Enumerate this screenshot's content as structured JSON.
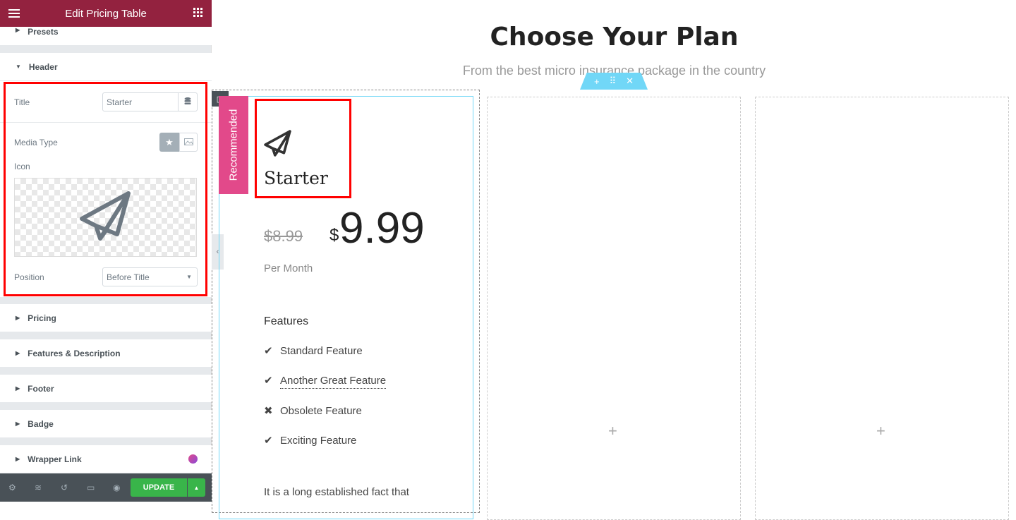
{
  "editor": {
    "title": "Edit Pricing Table",
    "menu_icon": "hamburger-icon",
    "apps_icon": "grid-icon",
    "sections": {
      "presets": "Presets",
      "header": "Header",
      "pricing": "Pricing",
      "features": "Features & Description",
      "footer": "Footer",
      "badge": "Badge",
      "wrapper_link": "Wrapper Link"
    },
    "controls": {
      "title_label": "Title",
      "title_value": "Starter",
      "media_type_label": "Media Type",
      "icon_label": "Icon",
      "position_label": "Position",
      "position_value": "Before Title"
    },
    "update_label": "UPDATE"
  },
  "page": {
    "heading": "Choose Your Plan",
    "subheading": "From the best micro insurance package in the country",
    "card": {
      "badge": "Recommended",
      "title": "Starter",
      "original_price": "$8.99",
      "currency": "$",
      "price": "9.99",
      "period": "Per Month",
      "features_heading": "Features",
      "features": [
        {
          "text": "Standard Feature",
          "icon": "check"
        },
        {
          "text": "Another Great Feature",
          "icon": "check"
        },
        {
          "text": "Obsolete Feature",
          "icon": "times"
        },
        {
          "text": "Exciting Feature",
          "icon": "check"
        }
      ],
      "description": "It is a long established fact that"
    }
  },
  "colors": {
    "brand": "#93223f",
    "badge": "#e2498a",
    "update": "#39b54a",
    "section_handle": "#71d7f7"
  }
}
